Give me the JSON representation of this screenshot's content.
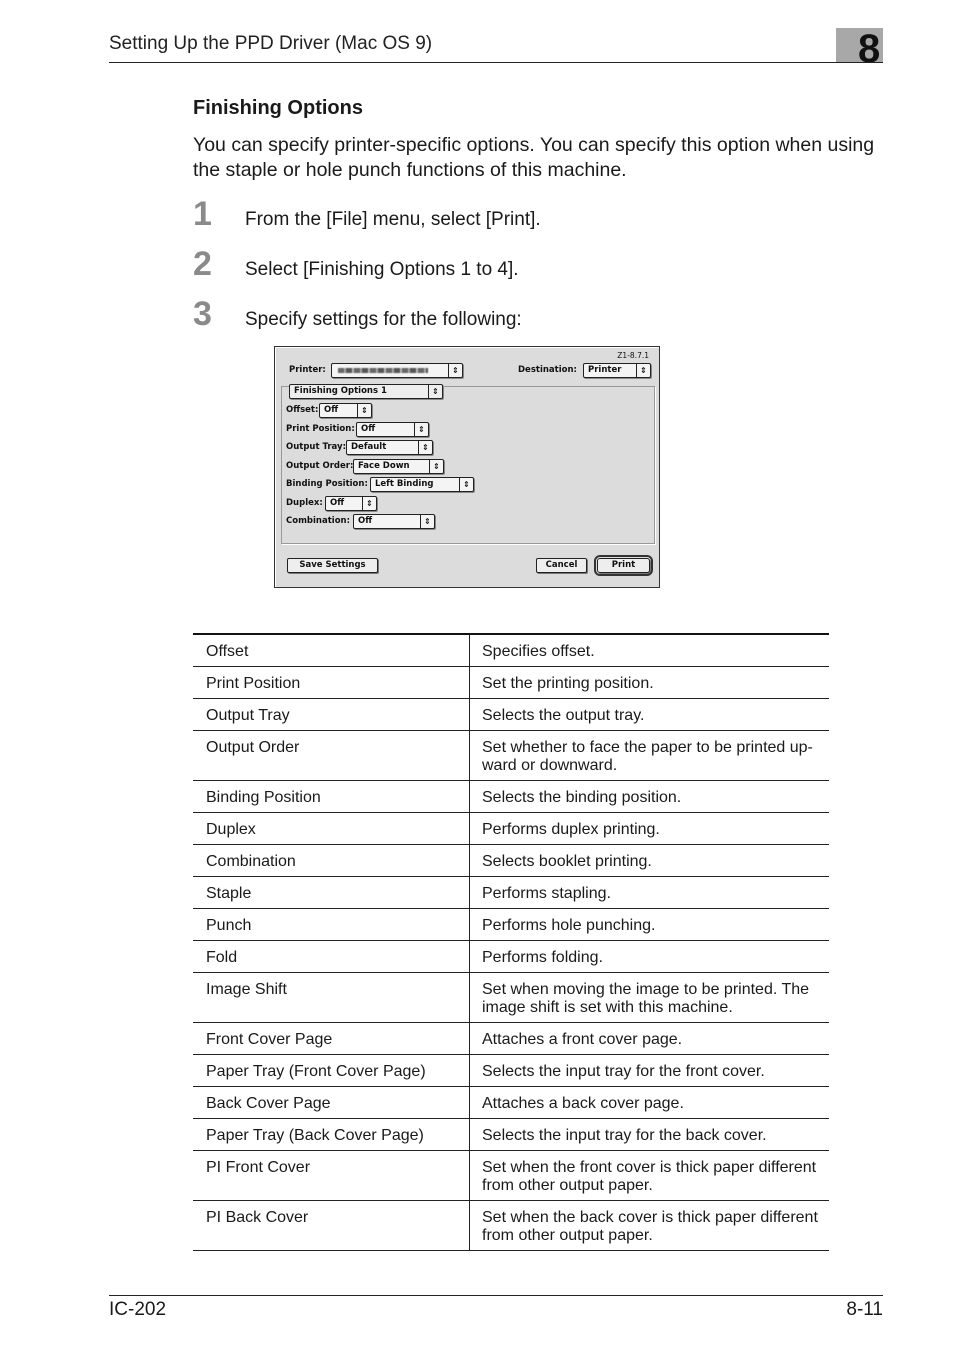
{
  "header": {
    "title": "Setting Up the PPD Driver (Mac OS 9)",
    "chapter": "8",
    "colors": {
      "chapter_box": "#a8a8a8"
    }
  },
  "section": {
    "title": "Finishing Options",
    "intro": "You can specify printer-specific options. You can specify this option when using the staple or hole punch functions of this machine."
  },
  "steps": [
    {
      "number": "1",
      "text": "From the [File] menu, select [Print]."
    },
    {
      "number": "2",
      "text": "Select [Finishing Options 1 to 4]."
    },
    {
      "number": "3",
      "text": "Specify settings for the following:"
    }
  ],
  "dialog": {
    "version": "Z1-8.7.1",
    "printer_label": "Printer:",
    "printer_value": "",
    "destination_label": "Destination:",
    "destination_value": "Printer",
    "panel_value": "Finishing Options 1",
    "fields": [
      {
        "label": "Offset:",
        "value": "Off"
      },
      {
        "label": "Print Position:",
        "value": "Off"
      },
      {
        "label": "Output Tray:",
        "value": "Default"
      },
      {
        "label": "Output Order:",
        "value": "Face Down"
      },
      {
        "label": "Binding Position:",
        "value": "Left Binding"
      },
      {
        "label": "Duplex:",
        "value": "Off"
      },
      {
        "label": "Combination:",
        "value": "Off"
      }
    ],
    "buttons": {
      "save_settings": "Save Settings",
      "cancel": "Cancel",
      "print": "Print"
    },
    "popup_arrow_icon": "⇕"
  },
  "table": {
    "rows": [
      {
        "item": "Offset",
        "description": "Specifies offset."
      },
      {
        "item": "Print Position",
        "description": "Set the printing position."
      },
      {
        "item": "Output Tray",
        "description": "Selects the output tray."
      },
      {
        "item": "Output Order",
        "description": "Set whether to face the paper to be printed up-ward or downward."
      },
      {
        "item": "Binding Position",
        "description": "Selects the binding position."
      },
      {
        "item": "Duplex",
        "description": "Performs duplex printing."
      },
      {
        "item": "Combination",
        "description": "Selects booklet printing."
      },
      {
        "item": "Staple",
        "description": "Performs stapling."
      },
      {
        "item": "Punch",
        "description": "Performs hole punching."
      },
      {
        "item": "Fold",
        "description": "Performs folding."
      },
      {
        "item": "Image Shift",
        "description": "Set when moving the image to be printed. The image shift is set with this machine."
      },
      {
        "item": "Front Cover Page",
        "description": "Attaches a front cover page."
      },
      {
        "item": "Paper Tray (Front Cover Page)",
        "description": "Selects the input tray for the front cover."
      },
      {
        "item": "Back Cover Page",
        "description": "Attaches a back cover page."
      },
      {
        "item": "Paper Tray (Back Cover Page)",
        "description": "Selects the input tray for the back cover."
      },
      {
        "item": "PI Front Cover",
        "description": "Set when the front cover is thick paper different from other output paper."
      },
      {
        "item": "PI Back Cover",
        "description": "Set when the back cover is thick paper different from other output paper."
      }
    ]
  },
  "footer": {
    "model": "IC-202",
    "page": "8-11"
  }
}
